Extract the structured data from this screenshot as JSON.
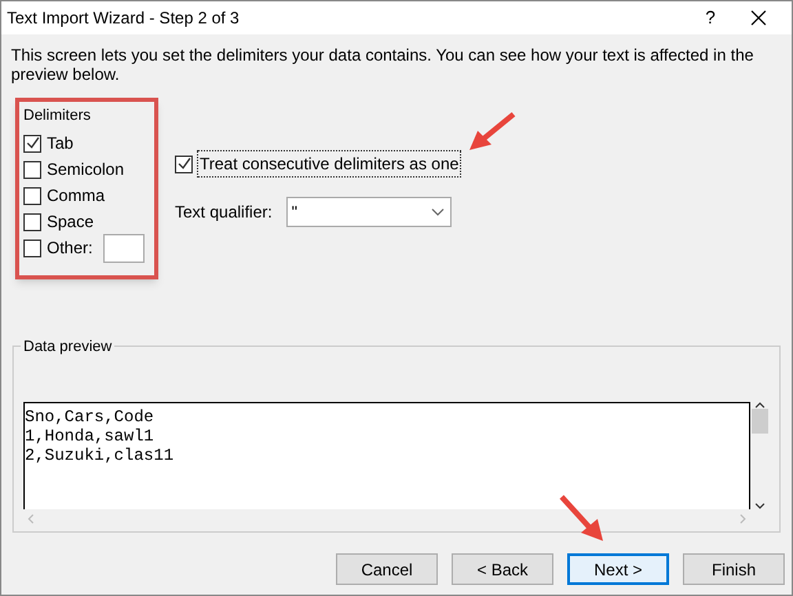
{
  "window": {
    "title": "Text Import Wizard - Step 2 of 3",
    "help": "?"
  },
  "intro": "This screen lets you set the delimiters your data contains.  You can see how your text is affected in the preview below.",
  "delimiters": {
    "title": "Delimiters",
    "items": [
      {
        "label": "Tab",
        "checked": true,
        "kind": "plain"
      },
      {
        "label": "Semicolon",
        "checked": false,
        "kind": "plain"
      },
      {
        "label": "Comma",
        "checked": false,
        "kind": "plain"
      },
      {
        "label": "Space",
        "checked": false,
        "kind": "plain"
      },
      {
        "label": "Other:",
        "checked": false,
        "kind": "with_field"
      }
    ]
  },
  "consecutive": {
    "label": "Treat consecutive delimiters as one",
    "checked": true
  },
  "qualifier": {
    "label": "Text qualifier:",
    "value": "\""
  },
  "preview": {
    "title": "Data preview",
    "lines": [
      "Sno,Cars,Code",
      "1,Honda,sawl1",
      "2,Suzuki,clas11"
    ]
  },
  "buttons": [
    {
      "label": "Cancel",
      "default": false
    },
    {
      "label": "< Back",
      "default": false
    },
    {
      "label": "Next >",
      "default": true
    },
    {
      "label": "Finish",
      "default": false
    }
  ]
}
